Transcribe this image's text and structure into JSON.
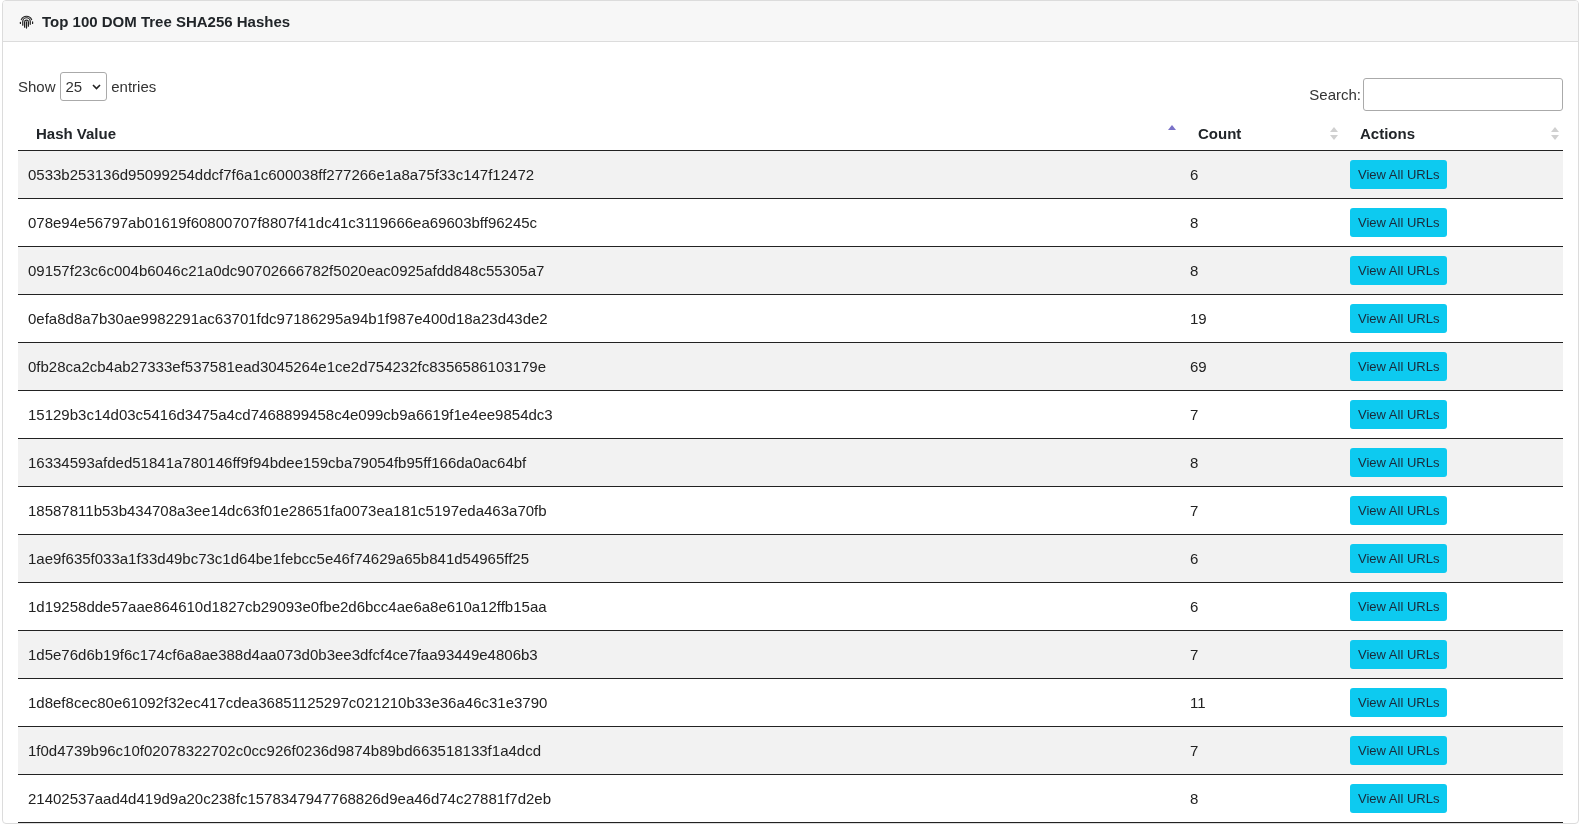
{
  "card": {
    "title": "Top 100 DOM Tree SHA256 Hashes"
  },
  "length_control": {
    "prefix": "Show",
    "value": "25",
    "suffix": "entries"
  },
  "search": {
    "label": "Search:"
  },
  "table": {
    "columns": [
      {
        "label": "Hash Value",
        "sorted": true
      },
      {
        "label": "Count",
        "sorted": false
      },
      {
        "label": "Actions",
        "sorted": false
      }
    ],
    "rows": [
      {
        "hash": "0533b253136d95099254ddcf7f6a1c600038ff277266e1a8a75f33c147f12472",
        "count": "6",
        "action": "View All URLs"
      },
      {
        "hash": "078e94e56797ab01619f60800707f8807f41dc41c3119666ea69603bff96245c",
        "count": "8",
        "action": "View All URLs"
      },
      {
        "hash": "09157f23c6c004b6046c21a0dc90702666782f5020eac0925afdd848c55305a7",
        "count": "8",
        "action": "View All URLs"
      },
      {
        "hash": "0efa8d8a7b30ae9982291ac63701fdc97186295a94b1f987e400d18a23d43de2",
        "count": "19",
        "action": "View All URLs"
      },
      {
        "hash": "0fb28ca2cb4ab27333ef537581ead3045264e1ce2d754232fc8356586103179e",
        "count": "69",
        "action": "View All URLs"
      },
      {
        "hash": "15129b3c14d03c5416d3475a4cd7468899458c4e099cb9a6619f1e4ee9854dc3",
        "count": "7",
        "action": "View All URLs"
      },
      {
        "hash": "16334593afded51841a780146ff9f94bdee159cba79054fb95ff166da0ac64bf",
        "count": "8",
        "action": "View All URLs"
      },
      {
        "hash": "18587811b53b434708a3ee14dc63f01e28651fa0073ea181c5197eda463a70fb",
        "count": "7",
        "action": "View All URLs"
      },
      {
        "hash": "1ae9f635f033a1f33d49bc73c1d64be1febcc5e46f74629a65b841d54965ff25",
        "count": "6",
        "action": "View All URLs"
      },
      {
        "hash": "1d19258dde57aae864610d1827cb29093e0fbe2d6bcc4ae6a8e610a12ffb15aa",
        "count": "6",
        "action": "View All URLs"
      },
      {
        "hash": "1d5e76d6b19f6c174cf6a8ae388d4aa073d0b3ee3dfcf4ce7faa93449e4806b3",
        "count": "7",
        "action": "View All URLs"
      },
      {
        "hash": "1d8ef8cec80e61092f32ec417cdea36851125297c021210b33e36a46c31e3790",
        "count": "11",
        "action": "View All URLs"
      },
      {
        "hash": "1f0d4739b96c10f02078322702c0cc926f0236d9874b89bd663518133f1a4dcd",
        "count": "7",
        "action": "View All URLs"
      },
      {
        "hash": "21402537aad4d419d9a20c238fc1578347947768826d9ea46d74c27881f7d2eb",
        "count": "8",
        "action": "View All URLs"
      }
    ]
  }
}
